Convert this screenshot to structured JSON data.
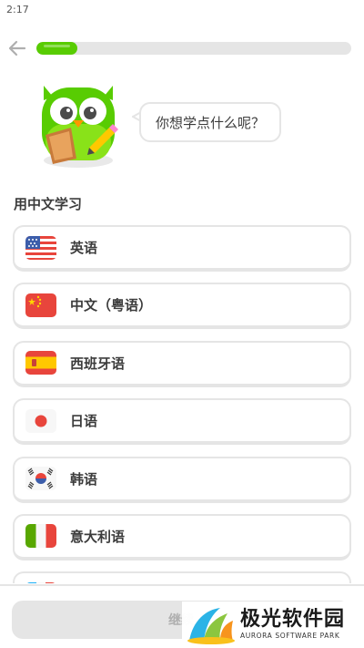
{
  "status_bar": {
    "time": "2:17"
  },
  "header": {
    "progress": 0.13
  },
  "mascot": {
    "speech": "你想学点什么呢？"
  },
  "section": {
    "title": "用中文学习"
  },
  "languages": [
    {
      "label": "英语",
      "flag": "us-flag-icon"
    },
    {
      "label": "中文（粤语）",
      "flag": "hk-flag-icon"
    },
    {
      "label": "西班牙语",
      "flag": "es-flag-icon"
    },
    {
      "label": "日语",
      "flag": "jp-flag-icon"
    },
    {
      "label": "韩语",
      "flag": "kr-flag-icon"
    },
    {
      "label": "意大利语",
      "flag": "it-flag-icon"
    },
    {
      "label": "",
      "flag": "partial-flag-icon"
    }
  ],
  "footer": {
    "continue_label": "继续"
  },
  "watermark": {
    "title": "极光软件园",
    "subtitle": "AURORA SOFTWARE PARK"
  },
  "colors": {
    "accent": "#58cc02",
    "border": "#e5e5e5",
    "text": "#3c3c3c",
    "disabled_text": "#afafaf"
  }
}
